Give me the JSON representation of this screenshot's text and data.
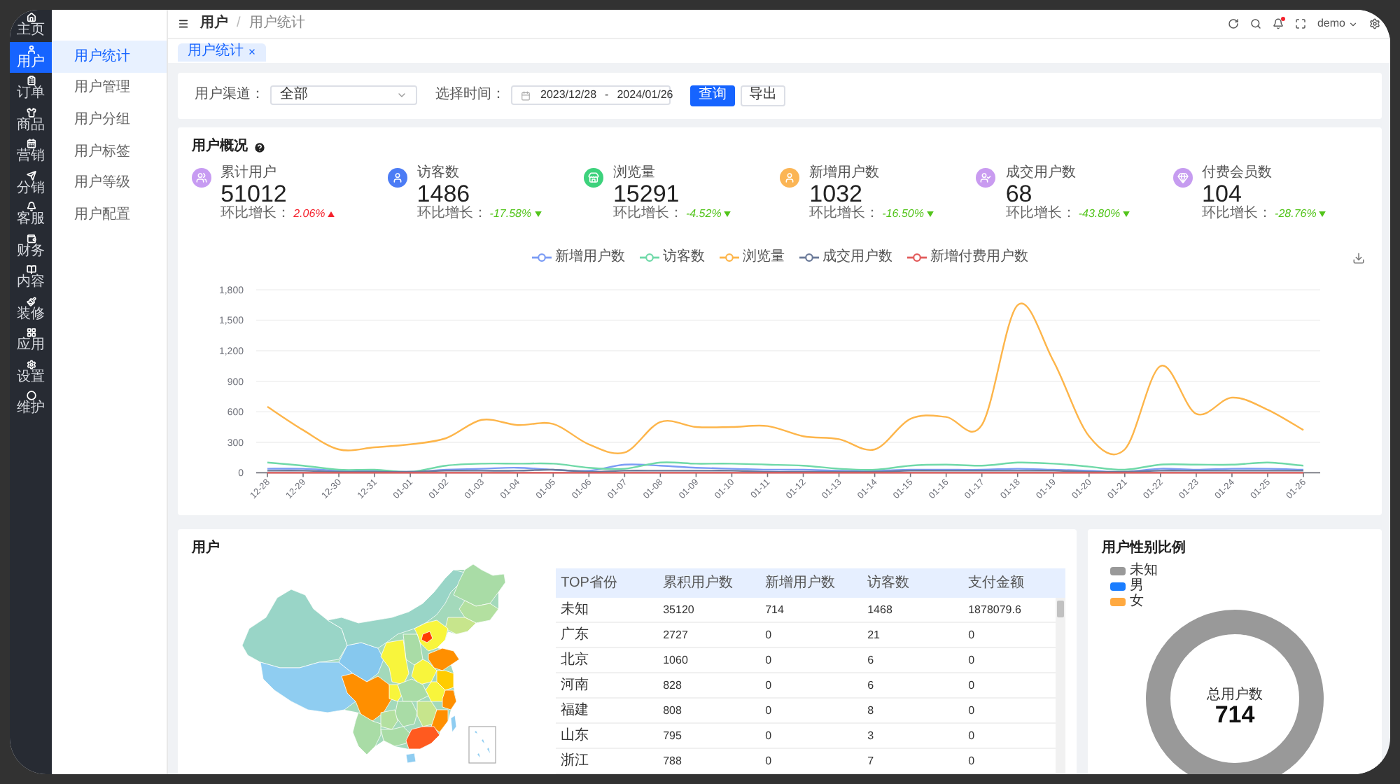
{
  "sidebar": {
    "items": [
      {
        "label": "主页",
        "selected": false
      },
      {
        "label": "用户",
        "selected": true
      },
      {
        "label": "订单",
        "selected": false
      },
      {
        "label": "商品",
        "selected": false
      },
      {
        "label": "营销",
        "selected": false
      },
      {
        "label": "分销",
        "selected": false
      },
      {
        "label": "客服",
        "selected": false
      },
      {
        "label": "财务",
        "selected": false
      },
      {
        "label": "内容",
        "selected": false
      },
      {
        "label": "装修",
        "selected": false
      },
      {
        "label": "应用",
        "selected": false
      },
      {
        "label": "设置",
        "selected": false
      },
      {
        "label": "维护",
        "selected": false
      }
    ]
  },
  "submenu": {
    "items": [
      {
        "label": "用户统计",
        "selected": true
      },
      {
        "label": "用户管理",
        "selected": false
      },
      {
        "label": "用户分组",
        "selected": false
      },
      {
        "label": "用户标签",
        "selected": false
      },
      {
        "label": "用户等级",
        "selected": false
      },
      {
        "label": "用户配置",
        "selected": false
      }
    ]
  },
  "header": {
    "breadcrumb": [
      "用户",
      "用户统计"
    ],
    "breadcrumb_separator": "/",
    "notification_dot": true,
    "user": "demo"
  },
  "tabs": [
    {
      "label": "用户统计",
      "selected": true,
      "closable": true
    }
  ],
  "filters": {
    "channel_label": "用户渠道：",
    "channel_value": "全部",
    "date_label": "选择时间：",
    "date_start": "2023/12/28",
    "date_separator": "-",
    "date_end": "2024/01/26",
    "buttons": [
      {
        "label": "查询",
        "kind": "primary"
      },
      {
        "label": "导出",
        "kind": "default"
      }
    ]
  },
  "overview": {
    "title": "用户概况",
    "stats": [
      {
        "label": "累计用户",
        "value": "51012",
        "change_label": "环比增长：",
        "change": "2.06%",
        "rising": true,
        "color": "#c79bf2"
      },
      {
        "label": "访客数",
        "value": "1486",
        "change_label": "环比增长：",
        "change": "-17.58%",
        "rising": false,
        "color": "#4c7cf5"
      },
      {
        "label": "浏览量",
        "value": "15291",
        "change_label": "环比增长：",
        "change": "-4.52%",
        "rising": false,
        "color": "#3dd27c"
      },
      {
        "label": "新增用户数",
        "value": "1032",
        "change_label": "环比增长：",
        "change": "-16.50%",
        "rising": false,
        "color": "#fbb555"
      },
      {
        "label": "成交用户数",
        "value": "68",
        "change_label": "环比增长：",
        "change": "-43.80%",
        "rising": false,
        "color": "#c99bf0"
      },
      {
        "label": "付费会员数",
        "value": "104",
        "change_label": "环比增长：",
        "change": "-28.76%",
        "rising": false,
        "color": "#c69cf0"
      }
    ],
    "chart_data": {
      "type": "line",
      "legend": "top",
      "grid": true,
      "categories": [
        "12-28",
        "12-29",
        "12-30",
        "12-31",
        "01-01",
        "01-02",
        "01-03",
        "01-04",
        "01-05",
        "01-06",
        "01-07",
        "01-08",
        "01-09",
        "01-10",
        "01-11",
        "01-12",
        "01-13",
        "01-14",
        "01-15",
        "01-16",
        "01-17",
        "01-18",
        "01-19",
        "01-20",
        "01-21",
        "01-22",
        "01-23",
        "01-24",
        "01-25",
        "01-26"
      ],
      "series": [
        {
          "name": "新增用户数",
          "color": "#7b9cf5",
          "values": [
            40,
            40,
            20,
            20,
            10,
            30,
            40,
            50,
            30,
            20,
            80,
            70,
            50,
            40,
            30,
            30,
            20,
            20,
            30,
            30,
            30,
            40,
            30,
            20,
            10,
            40,
            30,
            40,
            40,
            30
          ]
        },
        {
          "name": "访客数",
          "color": "#6fd9a8",
          "values": [
            100,
            70,
            30,
            30,
            10,
            70,
            90,
            90,
            90,
            50,
            40,
            100,
            90,
            90,
            80,
            70,
            40,
            30,
            70,
            80,
            70,
            100,
            90,
            60,
            30,
            80,
            80,
            80,
            100,
            70
          ]
        },
        {
          "name": "浏览量",
          "color": "#fdb54a",
          "values": [
            650,
            420,
            230,
            250,
            280,
            340,
            520,
            470,
            480,
            280,
            200,
            500,
            450,
            450,
            460,
            360,
            330,
            230,
            530,
            550,
            470,
            1650,
            1100,
            360,
            230,
            1050,
            580,
            740,
            620,
            420
          ]
        },
        {
          "name": "成交用户数",
          "color": "#6b7a99",
          "values": [
            20,
            20,
            10,
            10,
            10,
            20,
            20,
            20,
            30,
            10,
            20,
            20,
            20,
            20,
            10,
            10,
            10,
            10,
            20,
            20,
            20,
            20,
            20,
            10,
            10,
            20,
            20,
            20,
            20,
            20
          ]
        },
        {
          "name": "新增付费用户数",
          "color": "#e25c5c",
          "values": [
            0,
            0,
            0,
            0,
            0,
            0,
            0,
            0,
            0,
            0,
            0,
            0,
            0,
            0,
            0,
            0,
            0,
            0,
            0,
            0,
            0,
            0,
            0,
            0,
            0,
            0,
            0,
            0,
            0,
            0
          ]
        }
      ],
      "ylim": [
        0,
        1800
      ],
      "yticks": [
        {
          "value": 0,
          "label": "0"
        },
        {
          "value": 300,
          "label": "300"
        },
        {
          "value": 600,
          "label": "600"
        },
        {
          "value": 900,
          "label": "900"
        },
        {
          "value": 1200,
          "label": "1,200"
        },
        {
          "value": 1500,
          "label": "1,500"
        },
        {
          "value": 1800,
          "label": "1,800"
        }
      ]
    }
  },
  "distribution": {
    "title": "用户",
    "table": {
      "columns": [
        "TOP省份",
        "累积用户数",
        "新增用户数",
        "访客数",
        "支付金额"
      ],
      "rows": [
        [
          "未知",
          "35120",
          "714",
          "1468",
          "1878079.6"
        ],
        [
          "广东",
          "2727",
          "0",
          "21",
          "0"
        ],
        [
          "北京",
          "1060",
          "0",
          "6",
          "0"
        ],
        [
          "河南",
          "828",
          "0",
          "6",
          "0"
        ],
        [
          "福建",
          "808",
          "0",
          "8",
          "0"
        ],
        [
          "山东",
          "795",
          "0",
          "3",
          "0"
        ],
        [
          "浙江",
          "788",
          "0",
          "7",
          "0"
        ]
      ]
    }
  },
  "gender": {
    "title": "用户性别比例",
    "legend": [
      {
        "label": "未知",
        "color": "#999999"
      },
      {
        "label": "男",
        "color": "#1a7dff"
      },
      {
        "label": "女",
        "color": "#ffa940"
      }
    ],
    "center_label": "总用户数",
    "center_value": "714"
  }
}
